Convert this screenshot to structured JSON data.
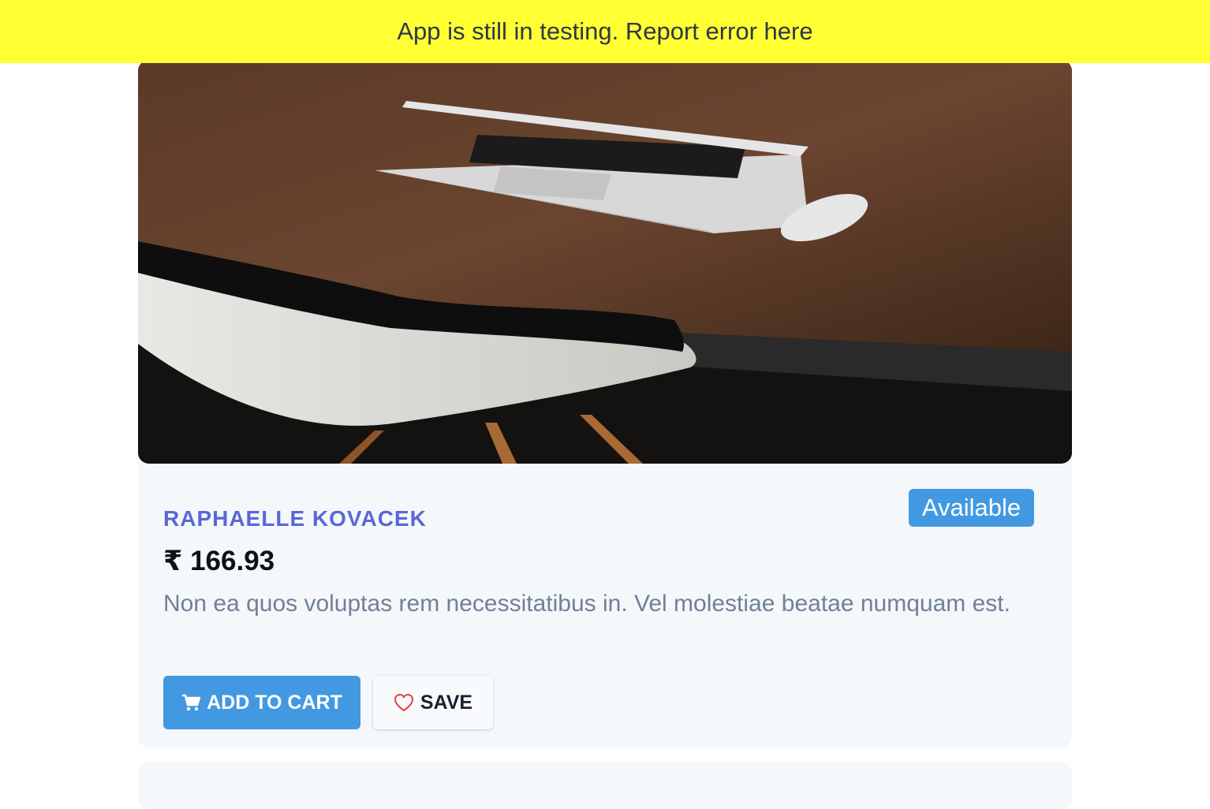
{
  "banner": {
    "text": "App is still in testing. Report error here"
  },
  "product": {
    "seller": "RAPHAELLE KOVACEK",
    "status": "Available",
    "price": "₹ 166.93",
    "description": "Non ea quos voluptas rem necessitatibus in. Vel molestiae beatae numquam est."
  },
  "actions": {
    "add_to_cart": "ADD TO CART",
    "save": "SAVE"
  },
  "icons": {
    "cart": "shopping-cart-icon",
    "save": "heart-icon"
  },
  "colors": {
    "banner_bg": "#ffff33",
    "accent": "#4299e1",
    "seller": "#5a67d8",
    "heart": "#e53e3e"
  }
}
